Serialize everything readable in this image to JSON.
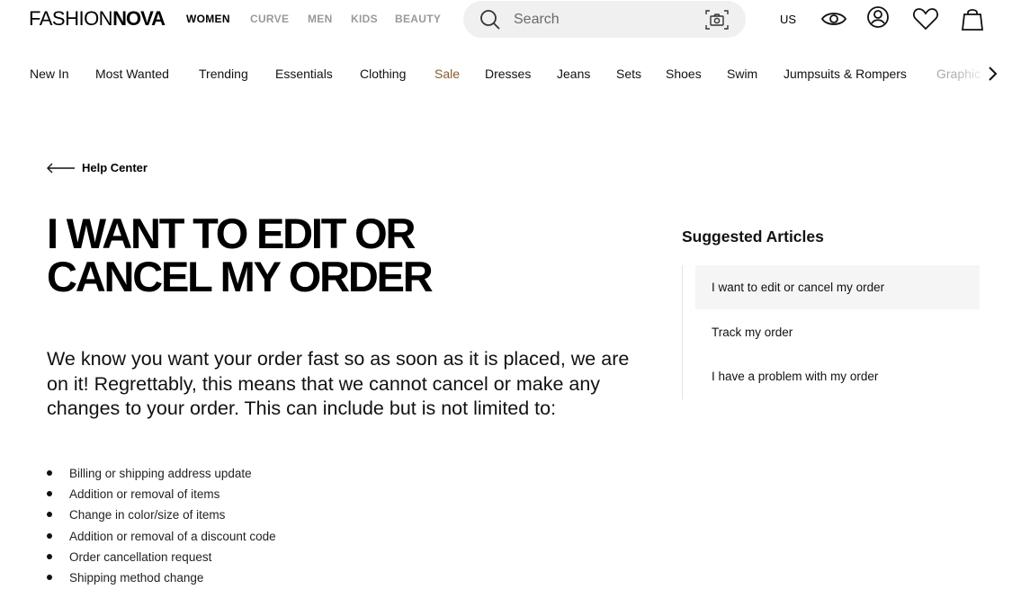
{
  "header": {
    "logo": {
      "light": "FASHION",
      "bold": "NOVA"
    },
    "departments": [
      "WOMEN",
      "CURVE",
      "MEN",
      "KIDS",
      "BEAUTY"
    ],
    "active_department": "WOMEN",
    "search": {
      "placeholder": "Search",
      "value": ""
    },
    "region": "US",
    "icons": [
      "eye-icon",
      "account-icon",
      "heart-icon",
      "bag-icon"
    ]
  },
  "nav": {
    "items": [
      "New In",
      "Most Wanted",
      "Trending",
      "Essentials",
      "Clothing",
      "Sale",
      "Dresses",
      "Jeans",
      "Sets",
      "Shoes",
      "Swim",
      "Jumpsuits & Rompers",
      "Graphic"
    ]
  },
  "breadcrumb": {
    "label": "Help Center"
  },
  "article": {
    "title_line1": "I WANT TO EDIT OR",
    "title_line2": "CANCEL MY ORDER",
    "intro": "We know you want your order fast so as soon as it is placed, we are on it! Regrettably, this means that we cannot cancel or make any changes to your order. This can include but is not limited to:",
    "bullets": [
      "Billing or shipping address update",
      "Addition or removal of items",
      "Change in color/size of items",
      "Addition or removal of a discount code",
      "Order cancellation request",
      "Shipping method change"
    ]
  },
  "sidebar": {
    "title": "Suggested Articles",
    "items": [
      "I want to edit or cancel my order",
      "Track my order",
      "I have a problem with my order"
    ],
    "active_index": 0
  },
  "colors": {
    "sale": "#8a5a2b",
    "inactive_dept": "#9a9a9a",
    "search_bg": "#f0f0f0"
  }
}
